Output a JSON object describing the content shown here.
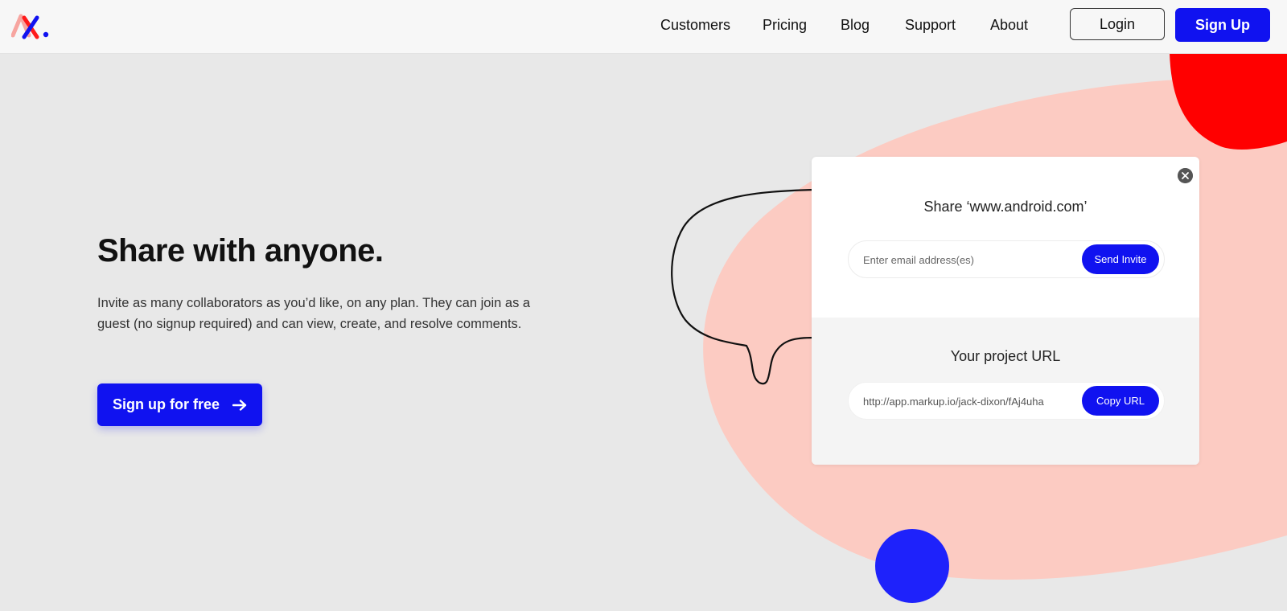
{
  "header": {
    "nav": [
      {
        "label": "Customers"
      },
      {
        "label": "Pricing"
      },
      {
        "label": "Blog"
      },
      {
        "label": "Support"
      },
      {
        "label": "About"
      }
    ],
    "login_label": "Login",
    "signup_label": "Sign Up"
  },
  "hero": {
    "title": "Share with anyone.",
    "description": "Invite as many collaborators as you’d like, on any plan. They can join as a guest (no signup required) and can view, create, and resolve comments.",
    "cta_label": "Sign up for free",
    "cta_icon": "arrow-right-icon"
  },
  "share_card": {
    "title": "Share ‘www.android.com’",
    "email_placeholder": "Enter email address(es)",
    "send_label": "Send Invite",
    "url_title": "Your project URL",
    "url_value": "http://app.markup.io/jack-dixon/fAj4uha",
    "copy_label": "Copy URL",
    "close_icon": "close-icon"
  },
  "colors": {
    "brand_blue": "#1012f0",
    "brand_red": "#ff0000",
    "blob_pink": "#fccbc2",
    "background": "#e8e8e8"
  }
}
